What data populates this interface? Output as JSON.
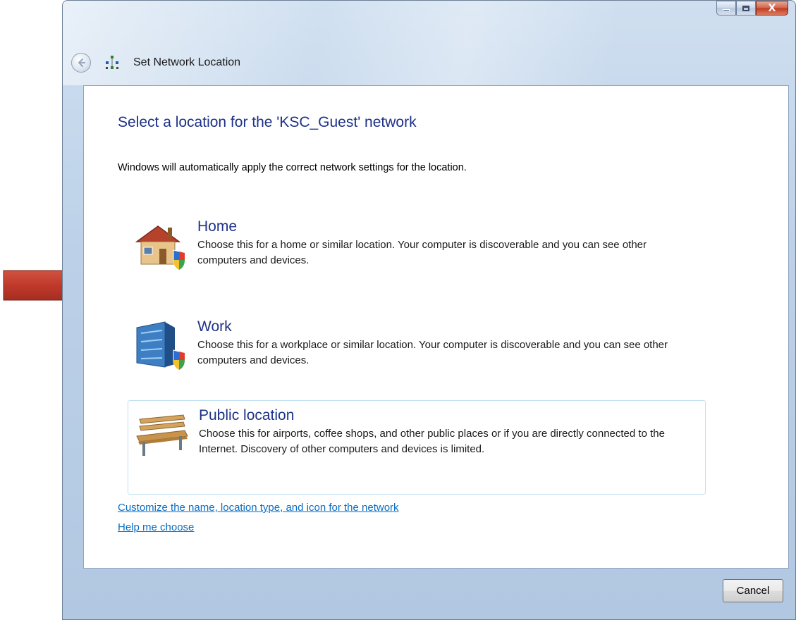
{
  "window": {
    "title": "Set Network Location",
    "caption_buttons": {
      "minimize": "",
      "maximize": "",
      "close": "X"
    }
  },
  "dialog": {
    "heading": "Select a location for the 'KSC_Guest' network",
    "intro": "Windows will automatically apply the correct network settings for the location.",
    "options": [
      {
        "title": "Home",
        "description": "Choose this for a home or similar location. Your computer is discoverable and you can see other computers and devices.",
        "icon": "house-shield-icon"
      },
      {
        "title": "Work",
        "description": "Choose this for a workplace or similar location. Your computer is discoverable and you can see other computers and devices.",
        "icon": "office-building-shield-icon"
      },
      {
        "title": "Public location",
        "description": "Choose this for airports, coffee shops, and other public places or if you are directly connected to the Internet. Discovery of other computers and devices is limited.",
        "icon": "park-bench-icon"
      }
    ],
    "links": {
      "customize": "Customize the name, location type, and icon for the network",
      "help": "Help me choose"
    },
    "cancel_label": "Cancel"
  },
  "annotation": {
    "icon": "red-pointer-arrow",
    "color": "#c0392b"
  },
  "colors": {
    "heading": "#1e3287",
    "link": "#0a6dc2",
    "hover_border": "#bfe0f3"
  }
}
